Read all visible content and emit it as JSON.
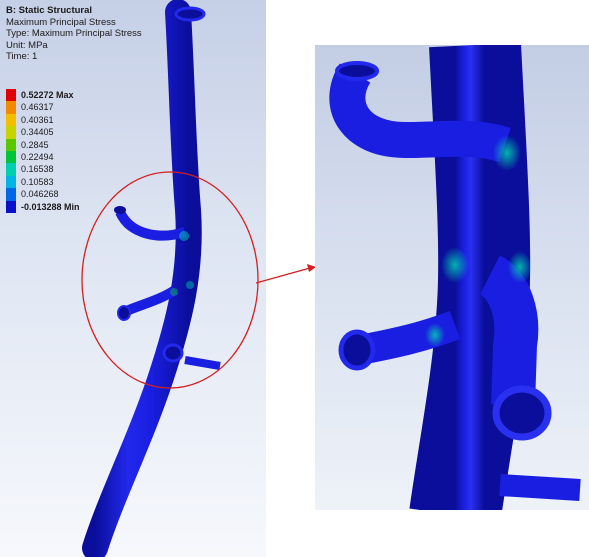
{
  "result": {
    "title": "B: Static Structural",
    "result_name": "Maximum Principal Stress",
    "type_line": "Type: Maximum Principal Stress",
    "unit_line": "Unit: MPa",
    "time_line": "Time: 1"
  },
  "legend": [
    {
      "label": "0.52272 Max",
      "color": "#e00000",
      "bold": true
    },
    {
      "label": "0.46317",
      "color": "#f28a00",
      "bold": false
    },
    {
      "label": "0.40361",
      "color": "#f3be00",
      "bold": false
    },
    {
      "label": "0.34405",
      "color": "#c8d400",
      "bold": false
    },
    {
      "label": "0.2845",
      "color": "#57c800",
      "bold": false
    },
    {
      "label": "0.22494",
      "color": "#00c53a",
      "bold": false
    },
    {
      "label": "0.16538",
      "color": "#00cfb2",
      "bold": false
    },
    {
      "label": "0.10583",
      "color": "#00b4e6",
      "bold": false
    },
    {
      "label": "0.046268",
      "color": "#0067e6",
      "bold": false
    },
    {
      "label": "-0.013288 Min",
      "color": "#0a10c8",
      "bold": true
    }
  ],
  "colors": {
    "model_blue": "#1a1ee0",
    "model_dark": "#0a0e9a",
    "highlight_ring": "#d42020",
    "arrow": "#d42020"
  }
}
